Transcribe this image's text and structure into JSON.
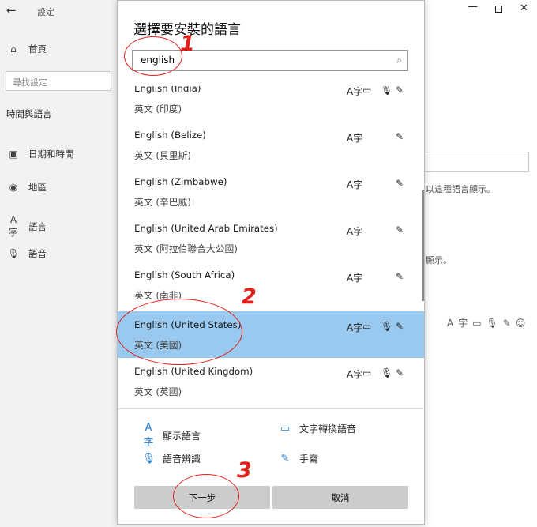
{
  "settings_window": {
    "title": "設定",
    "back_icon": "back-arrow-icon",
    "controls": {
      "minimize": "—",
      "close": "✕"
    },
    "sidebar": {
      "home": "首頁",
      "search_placeholder": "尋找設定",
      "section": "時間與語言",
      "items": [
        {
          "icon": "calendar-icon",
          "label": "日期和時間"
        },
        {
          "icon": "globe-icon",
          "label": "地區"
        },
        {
          "icon": "language-icon",
          "label": "語言"
        },
        {
          "icon": "microphone-icon",
          "label": "語音"
        }
      ]
    },
    "right_fragments": {
      "display_hint": "以這種語言顯示。",
      "display_hint_2": "顯示。"
    }
  },
  "dialog": {
    "title": "選擇要安裝的語言",
    "search": {
      "value": "english",
      "icon": "search-icon"
    },
    "languages": [
      {
        "name": "English (India)",
        "native": "英文 (印度)",
        "display": true,
        "tts": true,
        "speech": true,
        "handwriting": true,
        "selected": false
      },
      {
        "name": "English (Belize)",
        "native": "英文 (貝里斯)",
        "display": true,
        "tts": false,
        "speech": false,
        "handwriting": true,
        "selected": false
      },
      {
        "name": "English (Zimbabwe)",
        "native": "英文 (辛巴威)",
        "display": true,
        "tts": false,
        "speech": false,
        "handwriting": true,
        "selected": false
      },
      {
        "name": "English (United Arab Emirates)",
        "native": "英文 (阿拉伯聯合大公國)",
        "display": true,
        "tts": false,
        "speech": false,
        "handwriting": true,
        "selected": false
      },
      {
        "name": "English (South Africa)",
        "native": "英文 (南非)",
        "display": true,
        "tts": false,
        "speech": false,
        "handwriting": true,
        "selected": false
      },
      {
        "name": "English (United States)",
        "native": "英文 (美國)",
        "display": true,
        "tts": true,
        "speech": true,
        "handwriting": true,
        "selected": true
      },
      {
        "name": "English (United Kingdom)",
        "native": "英文 (英國)",
        "display": true,
        "tts": true,
        "speech": true,
        "handwriting": true,
        "selected": false
      }
    ],
    "legend": {
      "display": "顯示語言",
      "tts": "文字轉換語音",
      "speech": "語音辨識",
      "handwriting": "手寫"
    },
    "buttons": {
      "next": "下一步",
      "cancel": "取消"
    }
  },
  "annotations": [
    "1",
    "2",
    "3"
  ],
  "colors": {
    "selected_row": "#99c9ef",
    "accent_icon": "#1e7bd0",
    "annotation": "#e0201b",
    "button": "#cccccc"
  }
}
